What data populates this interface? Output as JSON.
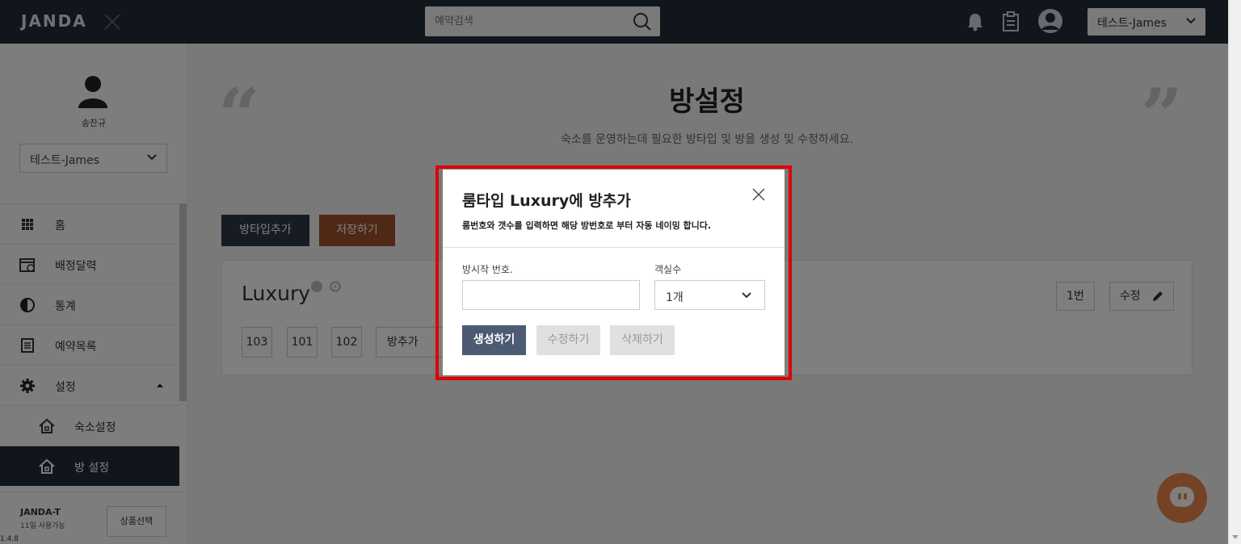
{
  "header": {
    "logo": "JANDA",
    "search_placeholder": "예약검색",
    "account": "테스트-James"
  },
  "sidebar": {
    "user_name": "송찬규",
    "property": "테스트-James",
    "items": [
      {
        "label": "홈",
        "icon": "grid-icon"
      },
      {
        "label": "배정달력",
        "icon": "calendar-icon"
      },
      {
        "label": "통계",
        "icon": "pie-chart-icon"
      },
      {
        "label": "예약목록",
        "icon": "list-icon"
      },
      {
        "label": "설정",
        "icon": "gear-icon"
      },
      {
        "label": "숙소설정",
        "icon": "house-icon"
      },
      {
        "label": "방 설정",
        "icon": "house-icon"
      }
    ],
    "plan_name": "JANDA-T",
    "plan_info": "11일 사용가능",
    "plan_button": "상품선택",
    "version": "1.4.8"
  },
  "main": {
    "title": "방설정",
    "subtitle": "숙소를 운영하는데 필요한 방타입 및 방을 생성 및 수정하세요.",
    "add_type_button": "방타입추가",
    "save_button": "저장하기",
    "room_type": {
      "name": "Luxury",
      "rooms": [
        "103",
        "101",
        "102"
      ],
      "add_room": "방추가",
      "count_label": "1번",
      "edit_label": "수정"
    }
  },
  "modal": {
    "title": "룸타입 Luxury에 방추가",
    "description": "룸번호와 갯수를 입력하면 해당 방번호로 부터 자동 네이밍 합니다.",
    "start_label": "방시작 번호.",
    "start_value": "",
    "count_label": "객실수",
    "count_value": "1개",
    "create_button": "생성하기",
    "edit_button": "수정하기",
    "delete_button": "삭제하기"
  },
  "colors": {
    "topbar": "#232c3b",
    "save_button": "#a0522d",
    "create_button": "#4c5a73",
    "highlight": "#e10000",
    "chat": "#e8844a"
  }
}
